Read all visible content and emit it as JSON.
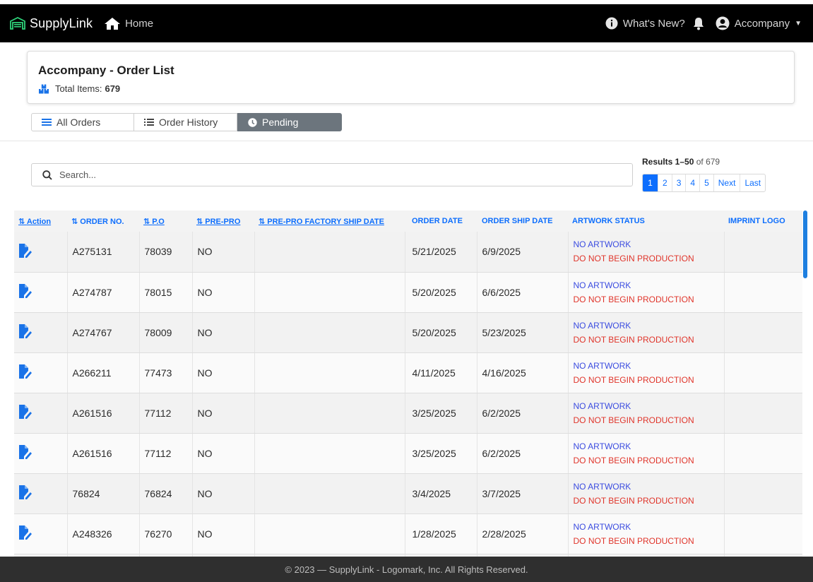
{
  "nav": {
    "brand": "SupplyLink",
    "home_label": "Home",
    "whats_new_label": "What's New?",
    "account_label": "Accompany"
  },
  "header": {
    "title": "Accompany - Order List",
    "total_label": "Total Items:",
    "total_value": "679"
  },
  "tabs": [
    {
      "label": "All Orders",
      "active": false
    },
    {
      "label": "Order History",
      "active": false
    },
    {
      "label": "Pending",
      "active": true
    }
  ],
  "search": {
    "placeholder": "Search...",
    "value": ""
  },
  "results": {
    "range": "Results 1–50",
    "of_text": "of 679"
  },
  "pagination": [
    "1",
    "2",
    "3",
    "4",
    "5",
    "Next",
    "Last"
  ],
  "table": {
    "columns": [
      "Action",
      "ORDER NO.",
      "P.O",
      "PRE-PRO",
      "PRE-PRO FACTORY SHIP DATE",
      "ORDER DATE",
      "ORDER SHIP DATE",
      "ARTWORK STATUS",
      "IMPRINT LOGO"
    ],
    "rows": [
      {
        "order_no": "A275131",
        "po": "78039",
        "prepro": "NO",
        "prepro_ship": "",
        "order_date": "5/21/2025",
        "ship_date": "6/9/2025",
        "status1": "NO ARTWORK",
        "status2": "DO NOT BEGIN PRODUCTION",
        "logo": ""
      },
      {
        "order_no": "A274787",
        "po": "78015",
        "prepro": "NO",
        "prepro_ship": "",
        "order_date": "5/20/2025",
        "ship_date": "6/6/2025",
        "status1": "NO ARTWORK",
        "status2": "DO NOT BEGIN PRODUCTION",
        "logo": ""
      },
      {
        "order_no": "A274767",
        "po": "78009",
        "prepro": "NO",
        "prepro_ship": "",
        "order_date": "5/20/2025",
        "ship_date": "5/23/2025",
        "status1": "NO ARTWORK",
        "status2": "DO NOT BEGIN PRODUCTION",
        "logo": ""
      },
      {
        "order_no": "A266211",
        "po": "77473",
        "prepro": "NO",
        "prepro_ship": "",
        "order_date": "4/11/2025",
        "ship_date": "4/16/2025",
        "status1": "NO ARTWORK",
        "status2": "DO NOT BEGIN PRODUCTION",
        "logo": ""
      },
      {
        "order_no": "A261516",
        "po": "77112",
        "prepro": "NO",
        "prepro_ship": "",
        "order_date": "3/25/2025",
        "ship_date": "6/2/2025",
        "status1": "NO ARTWORK",
        "status2": "DO NOT BEGIN PRODUCTION",
        "logo": ""
      },
      {
        "order_no": "A261516",
        "po": "77112",
        "prepro": "NO",
        "prepro_ship": "",
        "order_date": "3/25/2025",
        "ship_date": "6/2/2025",
        "status1": "NO ARTWORK",
        "status2": "DO NOT BEGIN PRODUCTION",
        "logo": ""
      },
      {
        "order_no": "76824",
        "po": "76824",
        "prepro": "NO",
        "prepro_ship": "",
        "order_date": "3/4/2025",
        "ship_date": "3/7/2025",
        "status1": "NO ARTWORK",
        "status2": "DO NOT BEGIN PRODUCTION",
        "logo": ""
      },
      {
        "order_no": "A248326",
        "po": "76270",
        "prepro": "NO",
        "prepro_ship": "",
        "order_date": "1/28/2025",
        "ship_date": "2/28/2025",
        "status1": "NO ARTWORK",
        "status2": "DO NOT BEGIN PRODUCTION",
        "logo": ""
      },
      {
        "order_no": "",
        "po": "",
        "prepro": "",
        "prepro_ship": "",
        "order_date": "",
        "ship_date": "",
        "status1": "",
        "status2": "",
        "logo": ""
      }
    ]
  },
  "footer": {
    "text": "© 2023 — SupplyLink - Logomark, Inc. All Rights Reserved."
  },
  "colors": {
    "topbar": "#000000",
    "accent": "#0d6efd",
    "pending_tab": "#6c757d",
    "status_blue": "#3b4ce0",
    "status_red": "#e0352b",
    "footer": "#2f2f2f"
  },
  "icons": {
    "brand": "warehouse-icon",
    "home": "home-icon",
    "whats_new": "info-circle-icon",
    "notifications": "bell-icon",
    "account": "user-circle-icon",
    "total": "boxes-icon",
    "all_orders": "bars-icon",
    "order_history": "list-icon",
    "pending": "clock-icon",
    "search": "search-icon",
    "edit": "file-edit-icon"
  }
}
